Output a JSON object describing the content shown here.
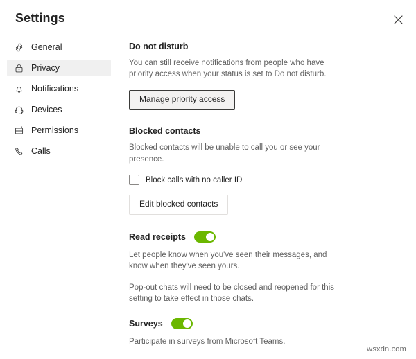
{
  "window": {
    "title": "Settings",
    "close_icon": "close-icon"
  },
  "sidebar": {
    "items": [
      {
        "label": "General",
        "icon": "gear-icon",
        "selected": false
      },
      {
        "label": "Privacy",
        "icon": "lock-icon",
        "selected": true
      },
      {
        "label": "Notifications",
        "icon": "bell-icon",
        "selected": false
      },
      {
        "label": "Devices",
        "icon": "headset-icon",
        "selected": false
      },
      {
        "label": "Permissions",
        "icon": "permissions-icon",
        "selected": false
      },
      {
        "label": "Calls",
        "icon": "phone-icon",
        "selected": false
      }
    ]
  },
  "main": {
    "do_not_disturb": {
      "heading": "Do not disturb",
      "description": "You can still receive notifications from people who have priority access when your status is set to Do not disturb.",
      "button_label": "Manage priority access"
    },
    "blocked_contacts": {
      "heading": "Blocked contacts",
      "description": "Blocked contacts will be unable to call you or see your presence.",
      "checkbox_label": "Block calls with no caller ID",
      "checkbox_checked": false,
      "button_label": "Edit blocked contacts"
    },
    "read_receipts": {
      "label": "Read receipts",
      "toggle_on": true,
      "description_1": "Let people know when you've seen their messages, and know when they've seen yours.",
      "description_2": "Pop-out chats will need to be closed and reopened for this setting to take effect in those chats."
    },
    "surveys": {
      "label": "Surveys",
      "toggle_on": true,
      "description": "Participate in surveys from Microsoft Teams."
    }
  },
  "watermark": {
    "text": "wsxdn.com"
  },
  "colors": {
    "toggle_on": "#6bb700",
    "selected_bg": "#f0f0f0",
    "text_primary": "#242424",
    "text_secondary": "#616161"
  }
}
